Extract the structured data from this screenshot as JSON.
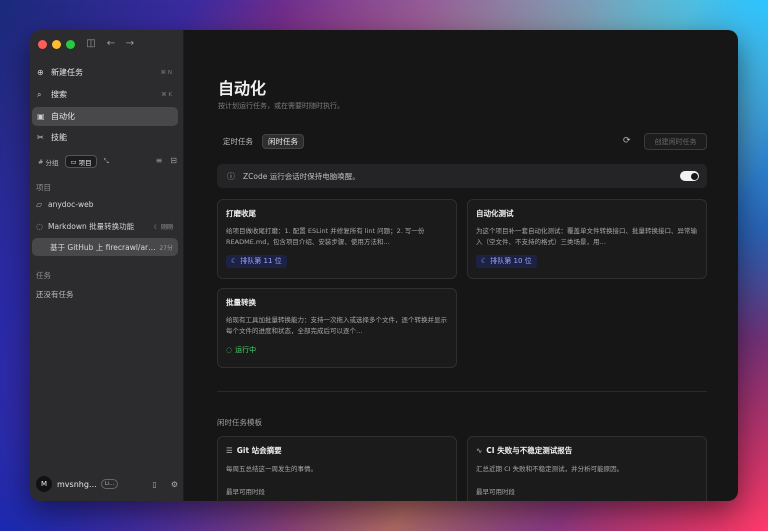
{
  "sidebar": {
    "nav": [
      {
        "label": "新建任务",
        "shortcut": "⌘ N"
      },
      {
        "label": "搜索",
        "shortcut": "⌘ K"
      },
      {
        "label": "自动化"
      },
      {
        "label": "技能"
      }
    ],
    "segments": [
      "分组",
      "项目"
    ],
    "projects_label": "项目",
    "projects": [
      {
        "label": "anydoc-web"
      },
      {
        "label": "Markdown 批量转换功能",
        "meta": "刚刚"
      },
      {
        "label": "基于 GitHub 上 firecrawl/ar…",
        "meta": "27分"
      }
    ],
    "tasks_label": "任务",
    "tasks_empty": "还没有任务",
    "user": {
      "initial": "M",
      "name": "mvsnhg…",
      "badge": "Li…"
    }
  },
  "main": {
    "title": "自动化",
    "subtitle": "按计划运行任务，或在需要时随时执行。",
    "tabs": [
      "定时任务",
      "闲时任务"
    ],
    "create_button": "创建闲时任务",
    "notice": "ZCode 运行会话时保持电脑唤醒。",
    "cards": [
      {
        "title": "打磨收尾",
        "desc": "给项目做收尾打磨：1. 配置 ESLint 并修复所有 lint 问题；2. 写一份 README.md，包含项目介绍、安装步骤、使用方法和…",
        "status": "排队第 11 位"
      },
      {
        "title": "自动化测试",
        "desc": "为这个项目补一套自动化测试：覆盖单文件转换接口、批量转换接口、异常输入（空文件、不支持的格式）三类场景，用…",
        "status": "排队第 10 位"
      },
      {
        "title": "批量转换",
        "desc": "给现有工具加批量转换能力：支持一次拖入或选择多个文件，逐个转换并显示每个文件的进度和状态，全部完成后可以逐个…",
        "status": "运行中"
      }
    ],
    "templates_label": "闲时任务模板",
    "templates": [
      {
        "title": "Git 站会摘要",
        "desc": "每周五总结这一周发生的事情。",
        "time": "最早可用时段"
      },
      {
        "title": "CI 失败与不稳定测试报告",
        "desc": "汇总近期 CI 失败和不稳定测试，并分析可能原因。",
        "time": "最早可用时段"
      }
    ]
  }
}
